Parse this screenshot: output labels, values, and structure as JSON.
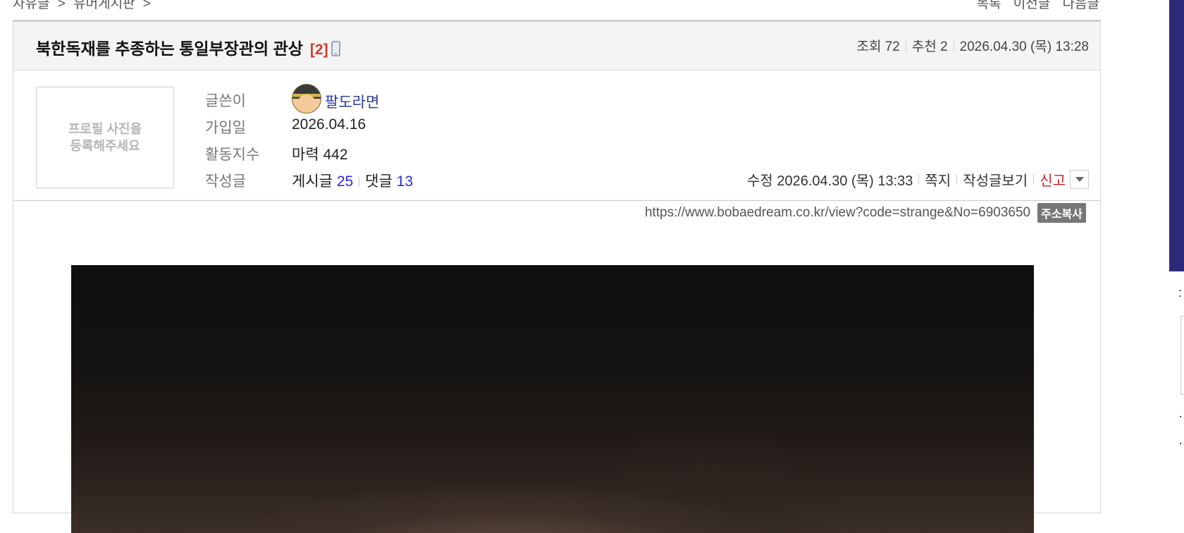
{
  "breadcrumb": {
    "items": [
      "자유글",
      ">",
      "유머게시판",
      ">"
    ]
  },
  "top_nav": {
    "list": "목록",
    "prev": "이전글",
    "next": "다음글"
  },
  "post": {
    "title": "북한독재를 추종하는 통일부장관의 관상",
    "comment_count": "[2]",
    "views": "조회 72",
    "recommend": "추천 2",
    "date": "2026.04.30 (목) 13:28"
  },
  "author": {
    "profile_placeholder": "프로필 사진을\n등록해주세요",
    "labels": {
      "writer": "글쓴이",
      "joined": "가입일",
      "activity": "활동지수",
      "posts": "작성글"
    },
    "nickname": "팔도라면",
    "joined_date": "2026.04.16",
    "activity": "마력 442",
    "posts_label": "게시글",
    "posts_count": "25",
    "comments_label": "댓글",
    "comments_count": "13"
  },
  "actions": {
    "modified": "수정 2026.04.30 (목) 13:33",
    "message": "쪽지",
    "view_posts": "작성글보기",
    "report": "신고"
  },
  "url": {
    "value": "https://www.bobaedream.co.kr/view?code=strange&No=6903650",
    "copy_label": "주소복사"
  }
}
